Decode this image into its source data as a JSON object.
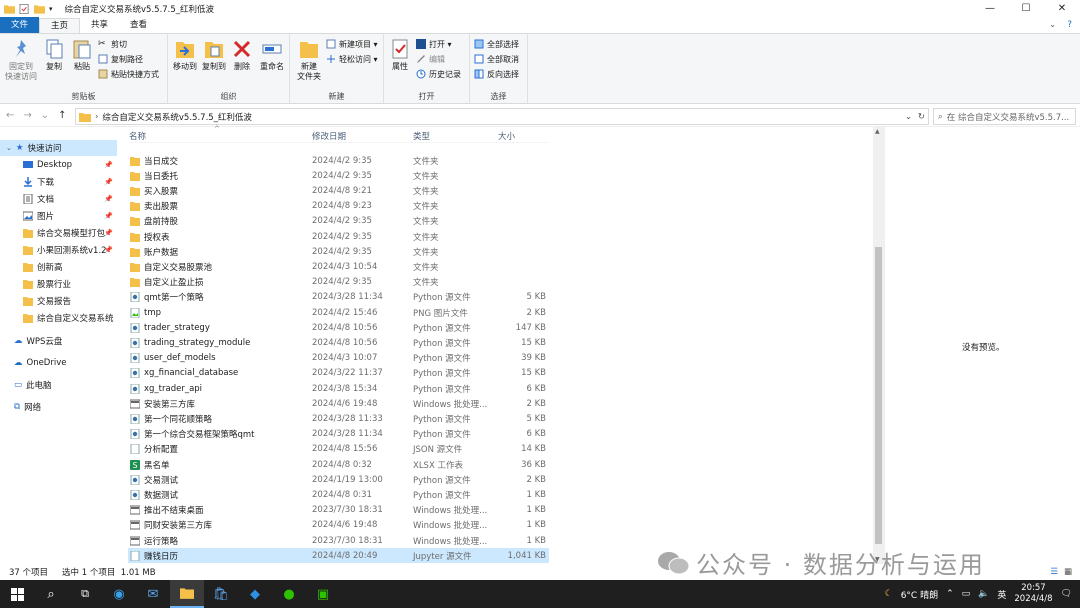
{
  "window": {
    "title": "综合自定义交易系统v5.5.7.5_红利低波",
    "controls": {
      "minimize": "—",
      "maximize": "☐",
      "close": "✕"
    }
  },
  "tabs": [
    "文件",
    "主页",
    "共享",
    "查看"
  ],
  "ribbon": {
    "clipboard": {
      "label": "剪贴板",
      "pin": "固定到\n快速访问",
      "copy": "复制",
      "paste": "粘贴",
      "cut": "剪切",
      "copy_path": "复制路径",
      "paste_shortcut": "粘贴快捷方式"
    },
    "organize": {
      "label": "组织",
      "move_to": "移动到",
      "copy_to": "复制到",
      "delete": "删除",
      "rename": "重命名"
    },
    "new": {
      "label": "新建",
      "new_folder": "新建\n文件夹",
      "new_item": "新建项目 ▾",
      "easy_access": "轻松访问 ▾"
    },
    "open": {
      "label": "打开",
      "properties": "属性",
      "open": "打开 ▾",
      "edit": "编辑",
      "history": "历史记录"
    },
    "select": {
      "label": "选择",
      "select_all": "全部选择",
      "select_none": "全部取消",
      "invert": "反向选择"
    }
  },
  "address": {
    "path": "综合自定义交易系统v5.5.7.5_红利低波",
    "search_placeholder": "在 综合自定义交易系统v5.5.7...",
    "nav": {
      "back": "←",
      "forward": "→",
      "recent": "⌄",
      "up": "↑"
    }
  },
  "sidebar": {
    "quick_access": "快速访问",
    "items": [
      {
        "label": "Desktop",
        "pinned": true
      },
      {
        "label": "下载",
        "pinned": true
      },
      {
        "label": "文档",
        "pinned": true
      },
      {
        "label": "图片",
        "pinned": true
      },
      {
        "label": "综合交易模型打包",
        "pinned": true
      },
      {
        "label": "小果回测系统v1.2",
        "pinned": true
      },
      {
        "label": "创新高",
        "pinned": false
      },
      {
        "label": "股票行业",
        "pinned": false
      },
      {
        "label": "交易报告",
        "pinned": false
      },
      {
        "label": "综合自定义交易系统",
        "pinned": false
      }
    ],
    "wps": "WPS云盘",
    "onedrive": "OneDrive",
    "this_pc": "此电脑",
    "network": "网络"
  },
  "columns": {
    "name": "名称",
    "date": "修改日期",
    "type": "类型",
    "size": "大小"
  },
  "files": [
    {
      "name": "当日成交",
      "date": "2024/4/2 9:35",
      "type": "文件夹",
      "size": "",
      "kind": "folder"
    },
    {
      "name": "当日委托",
      "date": "2024/4/2 9:35",
      "type": "文件夹",
      "size": "",
      "kind": "folder"
    },
    {
      "name": "买入股票",
      "date": "2024/4/8 9:21",
      "type": "文件夹",
      "size": "",
      "kind": "folder"
    },
    {
      "name": "卖出股票",
      "date": "2024/4/8 9:23",
      "type": "文件夹",
      "size": "",
      "kind": "folder"
    },
    {
      "name": "盘前持股",
      "date": "2024/4/2 9:35",
      "type": "文件夹",
      "size": "",
      "kind": "folder"
    },
    {
      "name": "授权表",
      "date": "2024/4/2 9:35",
      "type": "文件夹",
      "size": "",
      "kind": "folder"
    },
    {
      "name": "账户数据",
      "date": "2024/4/2 9:35",
      "type": "文件夹",
      "size": "",
      "kind": "folder"
    },
    {
      "name": "自定义交易股票池",
      "date": "2024/4/3 10:54",
      "type": "文件夹",
      "size": "",
      "kind": "folder"
    },
    {
      "name": "自定义止盈止损",
      "date": "2024/4/2 9:35",
      "type": "文件夹",
      "size": "",
      "kind": "folder"
    },
    {
      "name": "qmt第一个策略",
      "date": "2024/3/28 11:34",
      "type": "Python 源文件",
      "size": "5 KB",
      "kind": "py"
    },
    {
      "name": "tmp",
      "date": "2024/4/2 15:46",
      "type": "PNG 图片文件",
      "size": "2 KB",
      "kind": "png"
    },
    {
      "name": "trader_strategy",
      "date": "2024/4/8 10:56",
      "type": "Python 源文件",
      "size": "147 KB",
      "kind": "py"
    },
    {
      "name": "trading_strategy_module",
      "date": "2024/4/8 10:56",
      "type": "Python 源文件",
      "size": "15 KB",
      "kind": "py"
    },
    {
      "name": "user_def_models",
      "date": "2024/4/3 10:07",
      "type": "Python 源文件",
      "size": "39 KB",
      "kind": "py"
    },
    {
      "name": "xg_financial_database",
      "date": "2024/3/22 11:37",
      "type": "Python 源文件",
      "size": "15 KB",
      "kind": "py"
    },
    {
      "name": "xg_trader_api",
      "date": "2024/3/8 15:34",
      "type": "Python 源文件",
      "size": "6 KB",
      "kind": "py"
    },
    {
      "name": "安装第三方库",
      "date": "2024/4/6 19:48",
      "type": "Windows 批处理...",
      "size": "2 KB",
      "kind": "bat"
    },
    {
      "name": "第一个同花顺策略",
      "date": "2024/3/28 11:33",
      "type": "Python 源文件",
      "size": "5 KB",
      "kind": "py"
    },
    {
      "name": "第一个综合交易框架策略qmt",
      "date": "2024/3/28 11:34",
      "type": "Python 源文件",
      "size": "6 KB",
      "kind": "py"
    },
    {
      "name": "分析配置",
      "date": "2024/4/8 15:56",
      "type": "JSON 源文件",
      "size": "14 KB",
      "kind": "json"
    },
    {
      "name": "黑名单",
      "date": "2024/4/8 0:32",
      "type": "XLSX 工作表",
      "size": "36 KB",
      "kind": "xlsx"
    },
    {
      "name": "交易测试",
      "date": "2024/1/19 13:00",
      "type": "Python 源文件",
      "size": "2 KB",
      "kind": "py"
    },
    {
      "name": "数据测试",
      "date": "2024/4/8 0:31",
      "type": "Python 源文件",
      "size": "1 KB",
      "kind": "py"
    },
    {
      "name": "推出不结束桌面",
      "date": "2023/7/30 18:31",
      "type": "Windows 批处理...",
      "size": "1 KB",
      "kind": "bat"
    },
    {
      "name": "同财安装第三方库",
      "date": "2024/4/6 19:48",
      "type": "Windows 批处理...",
      "size": "1 KB",
      "kind": "bat"
    },
    {
      "name": "运行策略",
      "date": "2023/7/30 18:31",
      "type": "Windows 批处理...",
      "size": "1 KB",
      "kind": "bat"
    },
    {
      "name": "赚钱日历",
      "date": "2024/4/8 20:49",
      "type": "Jupyter 源文件",
      "size": "1,041 KB",
      "kind": "ipynb",
      "selected": true
    }
  ],
  "preview": {
    "text": "没有预览。"
  },
  "status": {
    "count": "37 个项目",
    "selection": "选中 1 个项目  1.01 MB"
  },
  "watermark": "公众号 · 数据分析与运用",
  "taskbar": {
    "weather": "6°C 晴朗",
    "ime": "英",
    "time": "20:57",
    "date": "2024/4/8"
  },
  "colors": {
    "accent": "#1a6fbf",
    "selection": "#cce8ff",
    "folder": "#f5c04a"
  }
}
